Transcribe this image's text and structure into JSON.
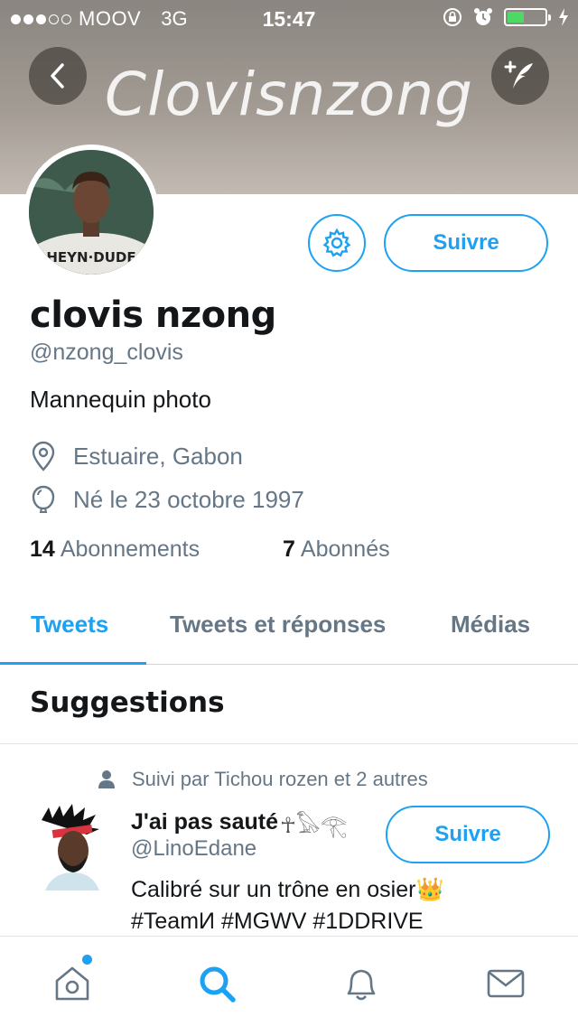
{
  "status_bar": {
    "carrier": "MOOV",
    "network": "3G",
    "time": "15:47",
    "signal_bars_filled": 3,
    "signal_bars_total": 5,
    "battery_level": 0.35
  },
  "header": {
    "title": "Clovisnzong",
    "back_icon": "chevron-left-icon",
    "compose_icon": "compose-tweet-icon"
  },
  "profile": {
    "name": "clovis nzong",
    "handle": "@nzong_clovis",
    "bio": "Mannequin photo",
    "location": "Estuaire, Gabon",
    "birthday": "Né le 23 octobre 1997",
    "following_count": "14",
    "following_label": "Abonnements",
    "followers_count": "7",
    "followers_label": "Abonnés",
    "follow_label": "Suivre"
  },
  "tabs": [
    {
      "label": "Tweets",
      "active": true
    },
    {
      "label": "Tweets et réponses",
      "active": false
    },
    {
      "label": "Médias",
      "active": false
    }
  ],
  "suggestions": {
    "title": "Suggestions",
    "item": {
      "context": "Suivi par Tichou rozen et 2 autres",
      "name": "J'ai pas sauté",
      "name_glyphs": "☥𓅃𓂀",
      "handle": "@LinoEdane",
      "bio_line1": "Calibré sur un trône en osier👑",
      "bio_line2": "#TeamИ #MGWV #1DDRIVE",
      "follow_label": "Suivre"
    }
  },
  "tabbar": {
    "items": [
      "home-icon",
      "search-icon",
      "notifications-icon",
      "messages-icon"
    ],
    "active": "search-icon"
  },
  "colors": {
    "accent": "#1da1f2",
    "secondary_text": "#657786",
    "primary_text": "#14171a"
  }
}
